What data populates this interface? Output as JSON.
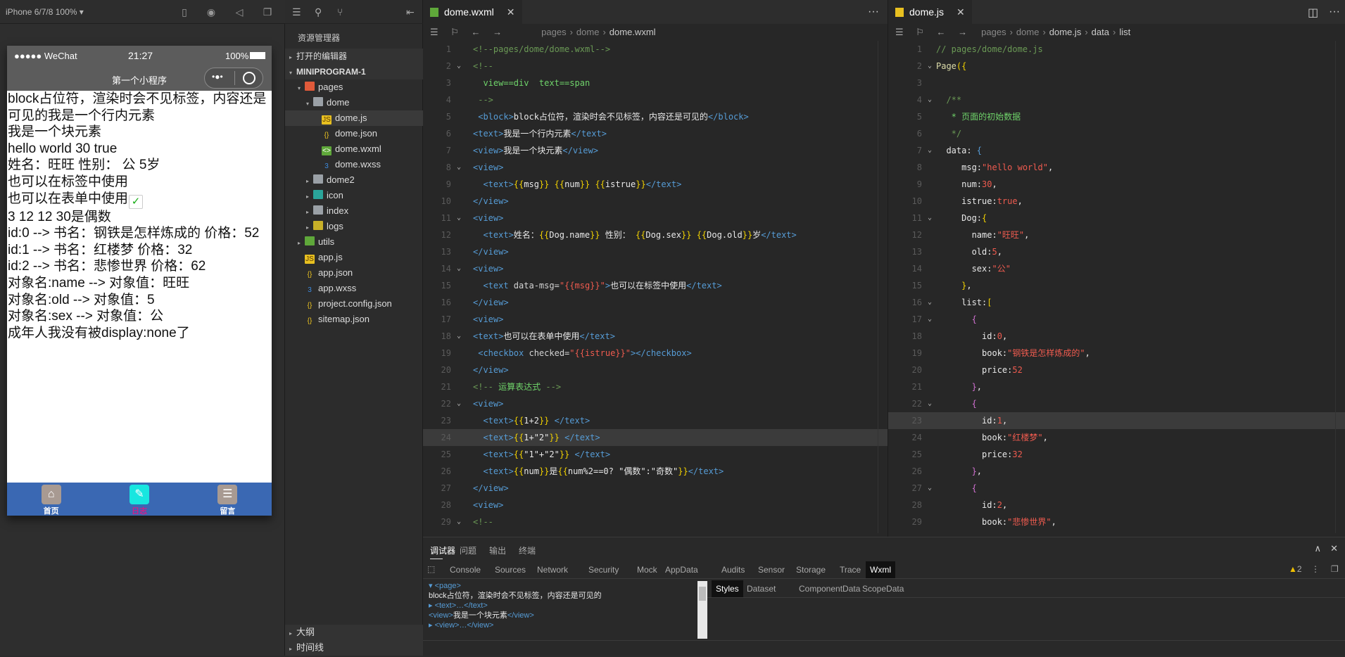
{
  "simulator": {
    "device_label": "iPhone 6/7/8 100% ▾",
    "status": {
      "carrier": "●●●●● WeChat",
      "time": "21:27",
      "battery": "100%"
    },
    "nav_title": "第一个小程序",
    "content_lines": [
      "block占位符，渲染时会不见标签，内容还是可见的我是一个行内元素",
      "我是一个块元素",
      "hello world 30 true",
      "姓名：旺旺 性别： 公 5岁",
      "也可以在标签中使用",
      "也可以在表单中使用",
      "3 12 12 30是偶数",
      "id:0 --> 书名：钢铁是怎样炼成的 价格：52",
      "id:1 --> 书名：红楼梦 价格：32",
      "id:2 --> 书名：悲惨世界 价格：62",
      "对象名:name --> 对象值：旺旺",
      "对象名:old --> 对象值：5",
      "对象名:sex --> 对象值：公",
      "成年人我没有被display:none了"
    ],
    "checkbox_checked": true,
    "tabbar": [
      {
        "label": "首页",
        "icon": "home-icon",
        "color": "#a89a92",
        "label_color": "#ffffff"
      },
      {
        "label": "日志",
        "icon": "edit-icon",
        "color": "#18e6e0",
        "label_color": "#d0208a"
      },
      {
        "label": "留言",
        "icon": "message-icon",
        "color": "#a89a92",
        "label_color": "#ffffff"
      }
    ],
    "tabbar_color": "#3a68b3"
  },
  "explorer": {
    "title": "资源管理器",
    "open_editors": "打开的编辑器",
    "project": "MINIPROGRAM-1",
    "tree": [
      {
        "label": "pages",
        "depth": 1,
        "kind": "folder-pages",
        "expanded": true
      },
      {
        "label": "dome",
        "depth": 2,
        "kind": "folder",
        "expanded": true
      },
      {
        "label": "dome.js",
        "depth": 3,
        "kind": "js",
        "selected": true
      },
      {
        "label": "dome.json",
        "depth": 3,
        "kind": "json"
      },
      {
        "label": "dome.wxml",
        "depth": 3,
        "kind": "wxml"
      },
      {
        "label": "dome.wxss",
        "depth": 3,
        "kind": "wxss"
      },
      {
        "label": "dome2",
        "depth": 2,
        "kind": "folder",
        "expanded": false
      },
      {
        "label": "icon",
        "depth": 2,
        "kind": "folder-icon",
        "expanded": false
      },
      {
        "label": "index",
        "depth": 2,
        "kind": "folder",
        "expanded": false
      },
      {
        "label": "logs",
        "depth": 2,
        "kind": "folder-logs",
        "expanded": false
      },
      {
        "label": "utils",
        "depth": 1,
        "kind": "folder-utils",
        "expanded": false
      },
      {
        "label": "app.js",
        "depth": 1,
        "kind": "js"
      },
      {
        "label": "app.json",
        "depth": 1,
        "kind": "json"
      },
      {
        "label": "app.wxss",
        "depth": 1,
        "kind": "wxss"
      },
      {
        "label": "project.config.json",
        "depth": 1,
        "kind": "json"
      },
      {
        "label": "sitemap.json",
        "depth": 1,
        "kind": "json"
      }
    ],
    "outline": "大纲",
    "timeline": "时间线"
  },
  "editors": [
    {
      "tab": "dome.wxml",
      "breadcrumb": [
        "pages",
        "dome",
        "dome.wxml"
      ],
      "current_line": 24,
      "folds": [
        2,
        8,
        11,
        14,
        18,
        22,
        29
      ],
      "lines": [
        [
          [
            "c",
            "<!--pages/dome/dome.wxml-->"
          ]
        ],
        [
          [
            "c",
            "<!--"
          ]
        ],
        [
          [
            "g",
            "  view==div  text==span"
          ]
        ],
        [
          [
            "c",
            " -->"
          ]
        ],
        [
          [
            "t",
            " <block>"
          ],
          [
            "x",
            "block占位符，渲染时会不见标签，内容还是可见的"
          ],
          [
            "t",
            "</block>"
          ]
        ],
        [
          [
            "t",
            "<text>"
          ],
          [
            "x",
            "我是一个行内元素"
          ],
          [
            "t",
            "</text>"
          ]
        ],
        [
          [
            "t",
            "<view>"
          ],
          [
            "x",
            "我是一个块元素"
          ],
          [
            "t",
            "</view>"
          ]
        ],
        [
          [
            "t",
            "<view>"
          ]
        ],
        [
          [
            "t",
            "  <text>"
          ],
          [
            "y",
            "{{"
          ],
          [
            "x",
            "msg"
          ],
          [
            "y",
            "}}"
          ],
          [
            "x",
            " "
          ],
          [
            "y",
            "{{"
          ],
          [
            "x",
            "num"
          ],
          [
            "y",
            "}}"
          ],
          [
            "x",
            " "
          ],
          [
            "y",
            "{{"
          ],
          [
            "x",
            "istrue"
          ],
          [
            "y",
            "}}"
          ],
          [
            "t",
            "</text>"
          ]
        ],
        [
          [
            "t",
            "</view>"
          ]
        ],
        [
          [
            "t",
            "<view>"
          ]
        ],
        [
          [
            "t",
            "  <text>"
          ],
          [
            "x",
            "姓名："
          ],
          [
            "y",
            "{{"
          ],
          [
            "x",
            "Dog.name"
          ],
          [
            "y",
            "}}"
          ],
          [
            "x",
            " 性别： "
          ],
          [
            "y",
            "{{"
          ],
          [
            "x",
            "Dog.sex"
          ],
          [
            "y",
            "}}"
          ],
          [
            "x",
            " "
          ],
          [
            "y",
            "{{"
          ],
          [
            "x",
            "Dog.old"
          ],
          [
            "y",
            "}}"
          ],
          [
            "x",
            "岁"
          ],
          [
            "t",
            "</text>"
          ]
        ],
        [
          [
            "t",
            "</view>"
          ]
        ],
        [
          [
            "t",
            "<view>"
          ]
        ],
        [
          [
            "t",
            "  <text "
          ],
          [
            "a",
            "data-msg="
          ],
          [
            "r",
            "\"{{msg}}\""
          ],
          [
            "t",
            ">"
          ],
          [
            "x",
            "也可以在标签中使用"
          ],
          [
            "t",
            "</text>"
          ]
        ],
        [
          [
            "t",
            "</view>"
          ]
        ],
        [
          [
            "t",
            "<view>"
          ]
        ],
        [
          [
            "t",
            "<text>"
          ],
          [
            "x",
            "也可以在表单中使用"
          ],
          [
            "t",
            "</text>"
          ]
        ],
        [
          [
            "t",
            " <checkbox "
          ],
          [
            "a",
            "checked="
          ],
          [
            "r",
            "\"{{istrue}}\""
          ],
          [
            "t",
            "></checkbox>"
          ]
        ],
        [
          [
            "t",
            "</view>"
          ]
        ],
        [
          [
            "c",
            "<!-- "
          ],
          [
            "g",
            "运算表达式"
          ],
          [
            "c",
            " -->"
          ]
        ],
        [
          [
            "t",
            "<view>"
          ]
        ],
        [
          [
            "t",
            "  <text>"
          ],
          [
            "y",
            "{{"
          ],
          [
            "x",
            "1+2"
          ],
          [
            "y",
            "}}"
          ],
          [
            "x",
            " "
          ],
          [
            "t",
            "</text>"
          ]
        ],
        [
          [
            "t",
            "  <text>"
          ],
          [
            "y",
            "{{"
          ],
          [
            "x",
            "1+\"2\""
          ],
          [
            "y",
            "}}"
          ],
          [
            "x",
            " "
          ],
          [
            "t",
            "</text>"
          ]
        ],
        [
          [
            "t",
            "  <text>"
          ],
          [
            "y",
            "{{"
          ],
          [
            "x",
            "\"1\"+\"2\""
          ],
          [
            "y",
            "}}"
          ],
          [
            "x",
            " "
          ],
          [
            "t",
            "</text>"
          ]
        ],
        [
          [
            "t",
            "  <text>"
          ],
          [
            "y",
            "{{"
          ],
          [
            "x",
            "num"
          ],
          [
            "y",
            "}}"
          ],
          [
            "x",
            "是"
          ],
          [
            "y",
            "{{"
          ],
          [
            "x",
            "num%2==0? \"偶数\":\"奇数\""
          ],
          [
            "y",
            "}}"
          ],
          [
            "t",
            "</text>"
          ]
        ],
        [
          [
            "t",
            "</view>"
          ]
        ],
        [
          [
            "t",
            "<view>"
          ]
        ],
        [
          [
            "c",
            "<!--"
          ]
        ]
      ]
    },
    {
      "tab": "dome.js",
      "breadcrumb": [
        "pages",
        "dome",
        "dome.js",
        "data",
        "list"
      ],
      "current_line": 23,
      "folds": [
        2,
        4,
        7,
        11,
        16,
        17,
        22,
        27
      ],
      "lines": [
        [
          [
            "c",
            "// pages/dome/dome.js"
          ]
        ],
        [
          [
            "f",
            "Page"
          ],
          [
            "y",
            "({"
          ]
        ],
        [],
        [
          [
            "c",
            "  /**"
          ]
        ],
        [
          [
            "g",
            "   * 页面的初始数据"
          ]
        ],
        [
          [
            "c",
            "   */"
          ]
        ],
        [
          [
            "k",
            "  data: "
          ],
          [
            "b",
            "{"
          ]
        ],
        [
          [
            "k",
            "     msg:"
          ],
          [
            "r",
            "\"hello world\""
          ],
          [
            "k",
            ","
          ]
        ],
        [
          [
            "k",
            "     num:"
          ],
          [
            "n",
            "30"
          ],
          [
            "k",
            ","
          ]
        ],
        [
          [
            "k",
            "     istrue:"
          ],
          [
            "n",
            "true"
          ],
          [
            "k",
            ","
          ]
        ],
        [
          [
            "k",
            "     Dog:"
          ],
          [
            "y",
            "{"
          ]
        ],
        [
          [
            "k",
            "       name:"
          ],
          [
            "r",
            "\"旺旺\""
          ],
          [
            "k",
            ","
          ]
        ],
        [
          [
            "k",
            "       old:"
          ],
          [
            "n",
            "5"
          ],
          [
            "k",
            ","
          ]
        ],
        [
          [
            "k",
            "       sex:"
          ],
          [
            "r",
            "\"公\""
          ]
        ],
        [
          [
            "y",
            "     }"
          ],
          [
            "k",
            ","
          ]
        ],
        [
          [
            "k",
            "     list:"
          ],
          [
            "y",
            "["
          ]
        ],
        [
          [
            "p",
            "       {"
          ]
        ],
        [
          [
            "k",
            "         id:"
          ],
          [
            "n",
            "0"
          ],
          [
            "k",
            ","
          ]
        ],
        [
          [
            "k",
            "         book:"
          ],
          [
            "r",
            "\"钢铁是怎样炼成的\""
          ],
          [
            "k",
            ","
          ]
        ],
        [
          [
            "k",
            "         price:"
          ],
          [
            "n",
            "52"
          ]
        ],
        [
          [
            "p",
            "       }"
          ],
          [
            "k",
            ","
          ]
        ],
        [
          [
            "p",
            "       {"
          ]
        ],
        [
          [
            "k",
            "         id:"
          ],
          [
            "n",
            "1"
          ],
          [
            "k",
            ","
          ]
        ],
        [
          [
            "k",
            "         book:"
          ],
          [
            "r",
            "\"红楼梦\""
          ],
          [
            "k",
            ","
          ]
        ],
        [
          [
            "k",
            "         price:"
          ],
          [
            "n",
            "32"
          ]
        ],
        [
          [
            "p",
            "       }"
          ],
          [
            "k",
            ","
          ]
        ],
        [
          [
            "p",
            "       {"
          ]
        ],
        [
          [
            "k",
            "         id:"
          ],
          [
            "n",
            "2"
          ],
          [
            "k",
            ","
          ]
        ],
        [
          [
            "k",
            "         book:"
          ],
          [
            "r",
            "\"悲惨世界\""
          ],
          [
            "k",
            ","
          ]
        ]
      ]
    }
  ],
  "debugger": {
    "panel_tabs": [
      "调试器",
      "问题",
      "输出",
      "终端"
    ],
    "devtools_tabs": [
      "Console",
      "Sources",
      "Network",
      "Security",
      "Mock",
      "AppData",
      "Audits",
      "Sensor",
      "Storage",
      "Trace",
      "Wxml"
    ],
    "active_devtools_tab": "Wxml",
    "warning_count": "2",
    "wxml_tree": [
      {
        "markup": "▾ <page>",
        "text": ""
      },
      {
        "markup": "",
        "text": "  block占位符，渲染时会不见标签，内容还是可见的"
      },
      {
        "markup": "  ▸ <text>…</text>",
        "text": ""
      },
      {
        "markup": "  <view>",
        "text": "我是一个块元素",
        "close": "</view>"
      },
      {
        "markup": "  ▸ <view>…</view>",
        "text": ""
      }
    ],
    "style_tabs": [
      "Styles",
      "Dataset",
      "ComponentData",
      "ScopeData"
    ]
  }
}
